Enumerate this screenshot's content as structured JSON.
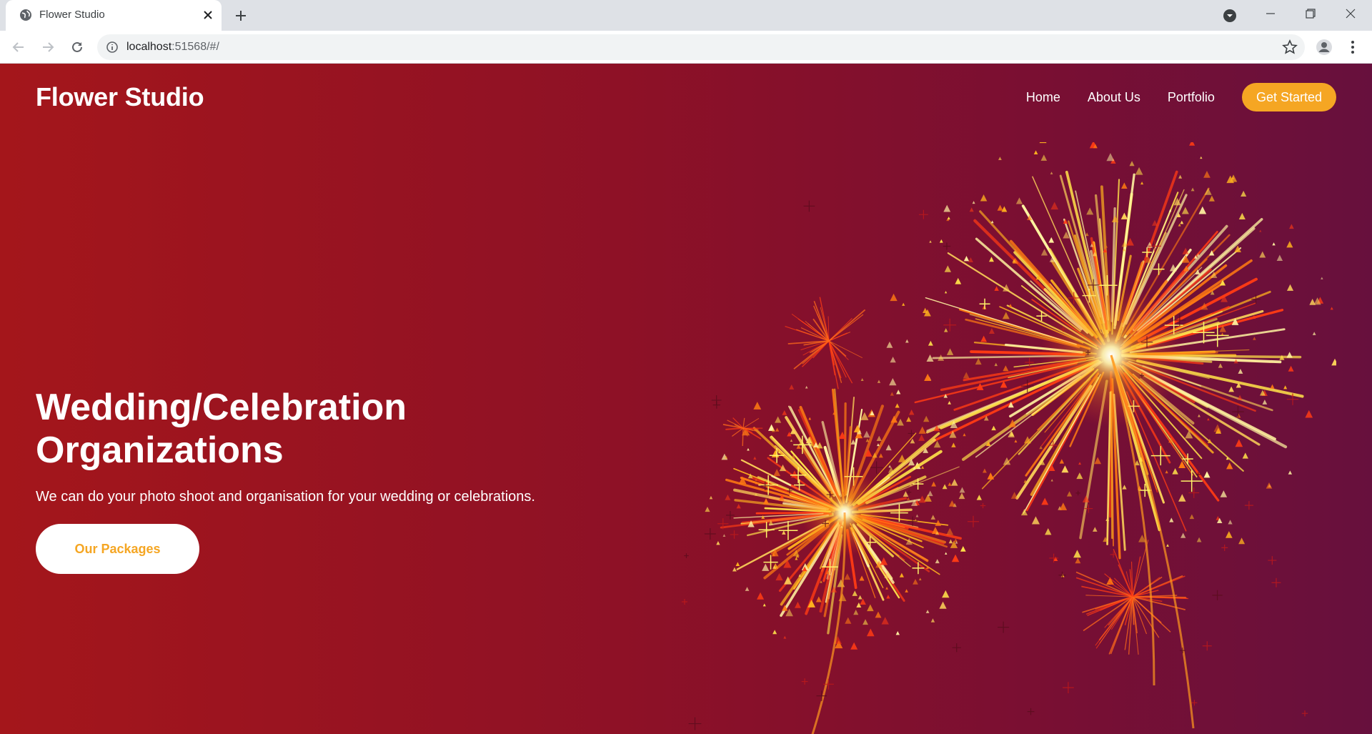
{
  "browser": {
    "tab_title": "Flower Studio",
    "url_host": "localhost",
    "url_path": ":51568/#/",
    "icons": {
      "favicon": "globe-icon",
      "tab_close": "close-icon",
      "new_tab": "plus-icon",
      "back": "arrow-left-icon",
      "forward": "arrow-right-icon",
      "reload": "reload-icon",
      "site_info": "info-icon",
      "bookmark": "star-icon",
      "profile": "account-icon",
      "menu": "kebab-menu-icon",
      "minimize": "minimize-icon",
      "maximize": "restore-icon",
      "close_window": "close-icon"
    }
  },
  "header": {
    "brand": "Flower Studio",
    "nav": [
      "Home",
      "About Us",
      "Portfolio"
    ],
    "cta": "Get Started"
  },
  "hero": {
    "title_line1": "Wedding/Celebration",
    "title_line2": "Organizations",
    "subtitle": "We can do your photo shoot and organisation for your wedding or celebrations.",
    "button": "Our Packages"
  },
  "colors": {
    "accent": "#f5a623",
    "gradient_start": "#a4161b",
    "gradient_end": "#67103d",
    "text": "#ffffff"
  }
}
